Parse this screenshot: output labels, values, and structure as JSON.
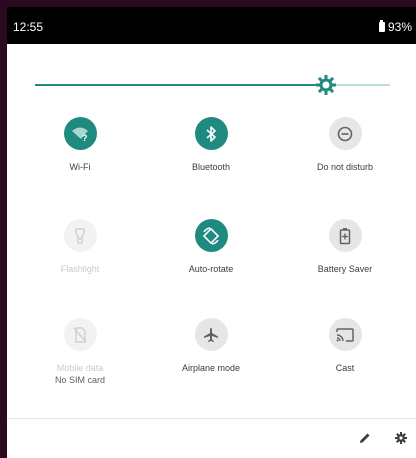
{
  "status_bar": {
    "time": "12:55",
    "battery": "93%"
  },
  "brightness": {
    "level": 0.76
  },
  "tiles": [
    {
      "label": "Wi-Fi",
      "icon": "wifi-icon",
      "state": "on"
    },
    {
      "label": "Bluetooth",
      "icon": "bluetooth-icon",
      "state": "on"
    },
    {
      "label": "Do not disturb",
      "icon": "do-not-disturb-icon",
      "state": "off"
    },
    {
      "label": "Flashlight",
      "icon": "flashlight-icon",
      "state": "unavailable"
    },
    {
      "label": "Auto-rotate",
      "icon": "auto-rotate-icon",
      "state": "on"
    },
    {
      "label": "Battery Saver",
      "icon": "battery-saver-icon",
      "state": "off"
    },
    {
      "label": "Mobile data",
      "sublabel": "No SIM card",
      "icon": "mobile-data-icon",
      "state": "unavailable"
    },
    {
      "label": "Airplane mode",
      "icon": "airplane-icon",
      "state": "off"
    },
    {
      "label": "Cast",
      "icon": "cast-icon",
      "state": "off"
    }
  ],
  "colors": {
    "accent": "#1f8a80",
    "tile_off": "#e6e6e6",
    "status_bar": "#000000"
  }
}
